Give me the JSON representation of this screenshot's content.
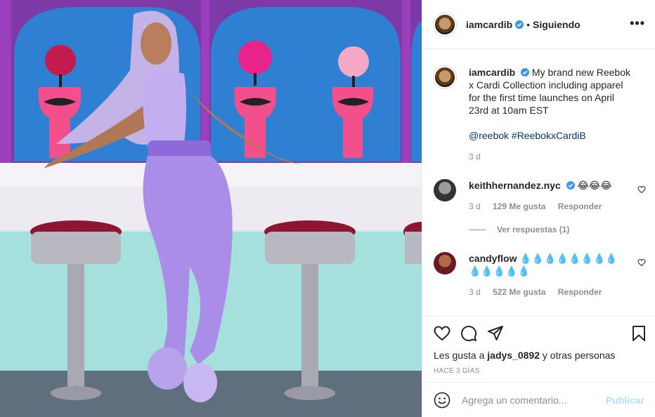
{
  "post": {
    "author": "iamcardib",
    "follow_status": "Siguiendo",
    "separator": "•",
    "more_label": "•••",
    "caption": "My brand new Reebok x Cardi Collection including apparel for the first time launches on April 23rd at 10am EST",
    "tags": "@reebok #ReebokxCardiB",
    "caption_age": "3 d"
  },
  "comments": [
    {
      "user": "keithhernandez.nyc",
      "text": "😂😂😂",
      "age": "3 d",
      "likes": "129 Me gusta",
      "reply": "Responder",
      "view_replies": "Ver respuestas (1)"
    },
    {
      "user": "candyflow",
      "text": "💧💧💧💧💧💧💧💧 💧💧💧💧💧",
      "age": "3 d",
      "likes": "522 Me gusta",
      "reply": "Responder"
    }
  ],
  "likes_line": {
    "prefix": "Les gusta a",
    "user": "jadys_0892",
    "suffix": "y otras personas"
  },
  "timestamp": "HACE 3 DÍAS",
  "comment_box": {
    "placeholder": "Agrega un comentario...",
    "publish_label": "Publicar"
  },
  "colors": {
    "verified": "#3897f0",
    "link": "#00376b",
    "muted": "#8e8e8e",
    "publish_disabled": "#b2dffc"
  }
}
